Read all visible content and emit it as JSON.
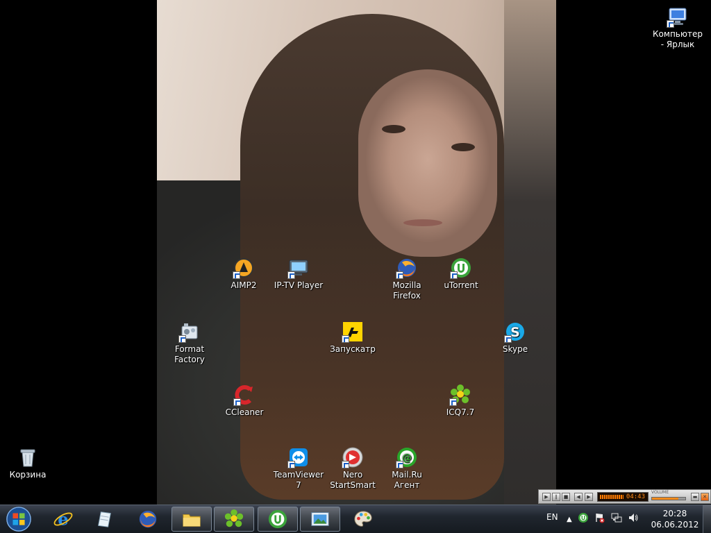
{
  "desktop_icons": [
    {
      "id": "computer",
      "label": "Компьютер - Ярлык"
    },
    {
      "id": "aimp2",
      "label": "AIMP2"
    },
    {
      "id": "iptv",
      "label": "IP-TV Player"
    },
    {
      "id": "firefox",
      "label": "Mozilla Firefox"
    },
    {
      "id": "utorrent",
      "label": "uTorrent"
    },
    {
      "id": "formatfactory",
      "label": "Format Factory"
    },
    {
      "id": "launcher",
      "label": "Запускатр"
    },
    {
      "id": "skype",
      "label": "Skype"
    },
    {
      "id": "ccleaner",
      "label": "CCleaner"
    },
    {
      "id": "icq",
      "label": "ICQ7.7"
    },
    {
      "id": "recycle",
      "label": "Корзина"
    },
    {
      "id": "teamviewer",
      "label": "TeamViewer 7"
    },
    {
      "id": "nero",
      "label": "Nero StartSmart"
    },
    {
      "id": "mailru",
      "label": "Mail.Ru Агент"
    }
  ],
  "taskbar": {
    "pinned": [
      "internet-explorer",
      "notepad",
      "firefox",
      "explorer",
      "icq",
      "utorrent",
      "photo-viewer",
      "paint"
    ],
    "language": "EN",
    "clock": {
      "time": "20:28",
      "date": "06.06.2012"
    }
  },
  "aimp_mini": {
    "time": "04:43",
    "volume_label": "VOLUME",
    "volume_level": 0.8,
    "accent": "#f28a1a"
  }
}
